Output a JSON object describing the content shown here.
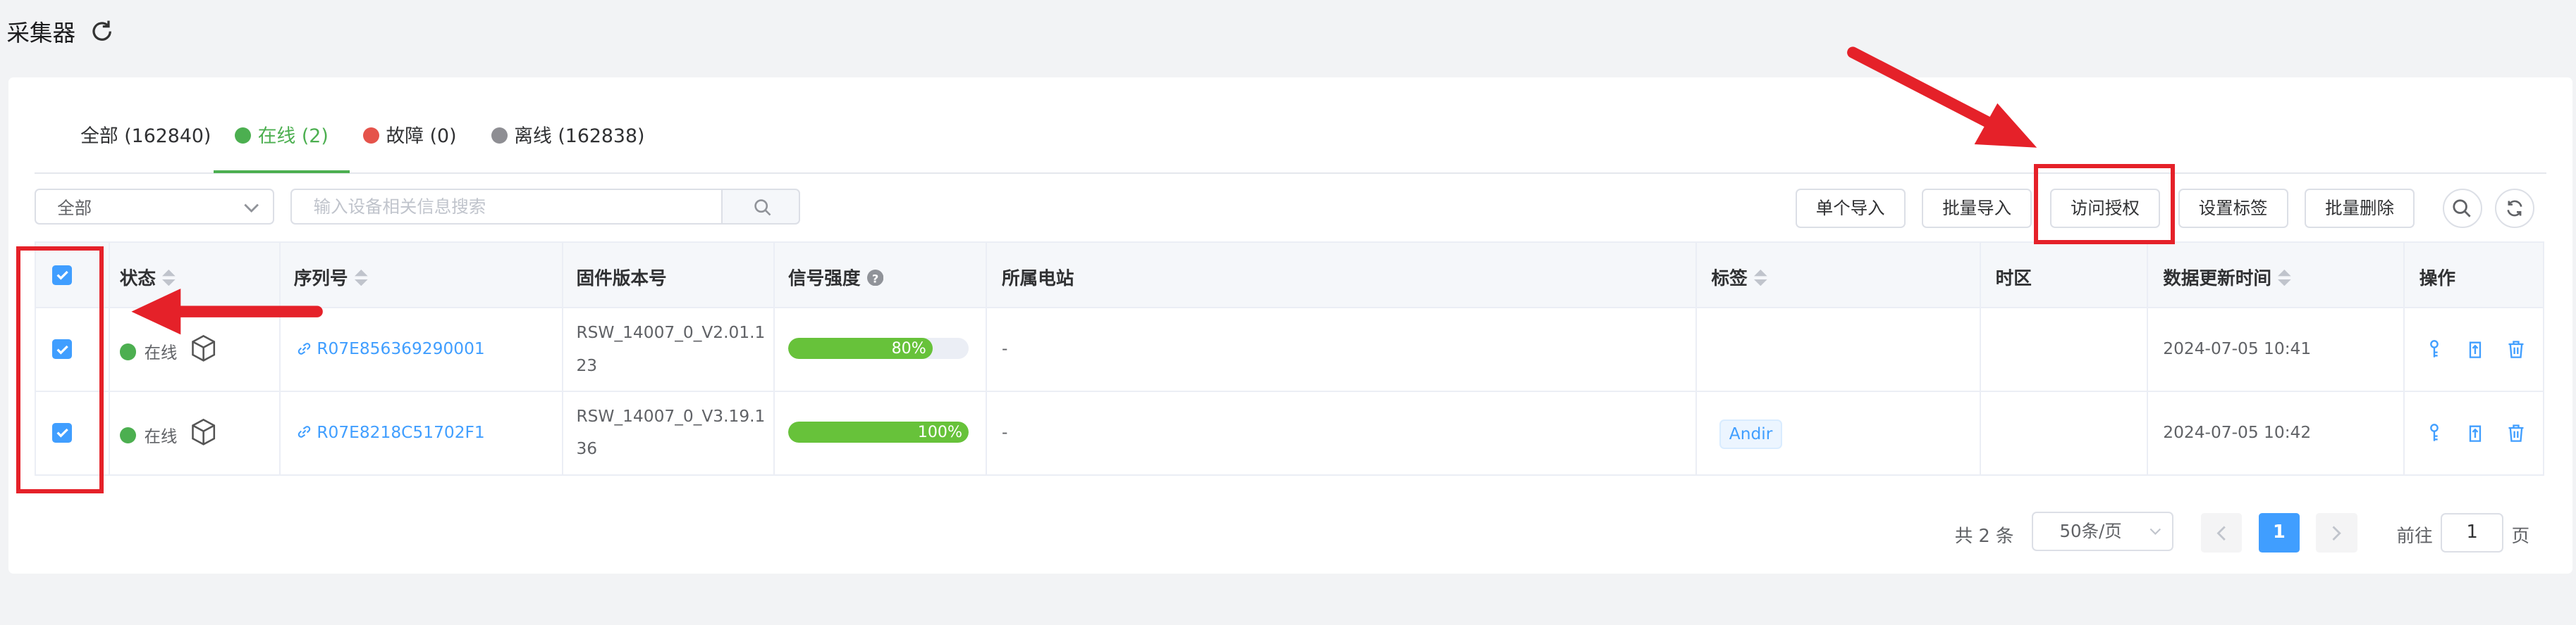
{
  "page": {
    "title": "采集器"
  },
  "tabs": [
    {
      "label": "全部 (162840)",
      "dot_color": ""
    },
    {
      "label": "在线 (2)",
      "dot_color": "#4caf50"
    },
    {
      "label": "故障 (0)",
      "dot_color": "#e5534b"
    },
    {
      "label": "离线 (162838)",
      "dot_color": "#8e8e93"
    }
  ],
  "filter": {
    "selected": "全部",
    "search_placeholder": "输入设备相关信息搜索"
  },
  "toolbar": {
    "single_import": "单个导入",
    "batch_import": "批量导入",
    "access_auth": "访问授权",
    "set_tag": "设置标签",
    "batch_delete": "批量删除"
  },
  "table": {
    "columns": [
      "状态",
      "序列号",
      "固件版本号",
      "信号强度",
      "所属电站",
      "标签",
      "时区",
      "数据更新时间",
      "操作"
    ],
    "rows": [
      {
        "status": "在线",
        "serial": "R07E856369290001",
        "firmware_line1": "RSW_14007_0_V2.01.1",
        "firmware_line2": "23",
        "signal": 80,
        "signal_label": "80%",
        "station": "-",
        "tag": "",
        "timezone": "",
        "updated": "2024-07-05 10:41"
      },
      {
        "status": "在线",
        "serial": "R07E8218C51702F1",
        "firmware_line1": "RSW_14007_0_V3.19.1",
        "firmware_line2": "36",
        "signal": 100,
        "signal_label": "100%",
        "station": "-",
        "tag": "Andir",
        "timezone": "",
        "updated": "2024-07-05 10:42"
      }
    ]
  },
  "pagination": {
    "total": "共 2 条",
    "page_size": "50条/页",
    "current_page": "1",
    "goto_label": "前往",
    "goto_value": "1",
    "page_suffix": "页"
  },
  "colors": {
    "accent": "#409eff",
    "online": "#4caf50",
    "annotation": "#e52129"
  }
}
